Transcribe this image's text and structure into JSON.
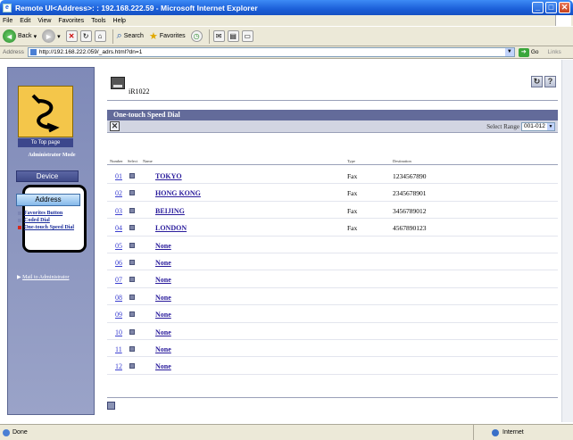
{
  "window": {
    "title": "Remote UI<Address>: : 192.168.222.59 - Microsoft Internet Explorer",
    "buttons": {
      "minimize": "_",
      "maximize": "□",
      "close": "✕"
    }
  },
  "menubar": [
    "File",
    "Edit",
    "View",
    "Favorites",
    "Tools",
    "Help"
  ],
  "toolbar": {
    "back": "Back",
    "search": "Search",
    "favorites": "Favorites"
  },
  "address_bar": {
    "label": "Address",
    "url": "http://192.168.222.059/_adrs.html?dn=1",
    "go": "Go",
    "links": "Links"
  },
  "sidebar": {
    "top_page": "To Top page",
    "mode": "Administrator Mode",
    "device": "Device",
    "address": "Address",
    "sub_items": [
      {
        "label": "Favorites Button"
      },
      {
        "label": "Coded Dial"
      },
      {
        "label": "One-touch Speed Dial"
      }
    ],
    "mail_link": "Mail to Administrator"
  },
  "device": {
    "name": "iR1022"
  },
  "panel": {
    "title": "One-touch Speed Dial",
    "range_label": "Select Range",
    "range_value": "001-012"
  },
  "list": {
    "headers": {
      "number": "Number",
      "select": "Select",
      "name": "Name",
      "type": "Type",
      "destination": "Destination"
    },
    "rows": [
      {
        "num": "01",
        "name": "TOKYO",
        "type": "Fax",
        "dest": "1234567890"
      },
      {
        "num": "02",
        "name": "HONG KONG",
        "type": "Fax",
        "dest": "2345678901"
      },
      {
        "num": "03",
        "name": "BEIJING",
        "type": "Fax",
        "dest": "3456789012"
      },
      {
        "num": "04",
        "name": "LONDON",
        "type": "Fax",
        "dest": "4567890123"
      },
      {
        "num": "05",
        "name": "None",
        "type": "",
        "dest": ""
      },
      {
        "num": "06",
        "name": "None",
        "type": "",
        "dest": ""
      },
      {
        "num": "07",
        "name": "None",
        "type": "",
        "dest": ""
      },
      {
        "num": "08",
        "name": "None",
        "type": "",
        "dest": ""
      },
      {
        "num": "09",
        "name": "None",
        "type": "",
        "dest": ""
      },
      {
        "num": "10",
        "name": "None",
        "type": "",
        "dest": ""
      },
      {
        "num": "11",
        "name": "None",
        "type": "",
        "dest": ""
      },
      {
        "num": "12",
        "name": "None",
        "type": "",
        "dest": ""
      }
    ]
  },
  "status": {
    "text": "Done",
    "zone": "Internet"
  }
}
